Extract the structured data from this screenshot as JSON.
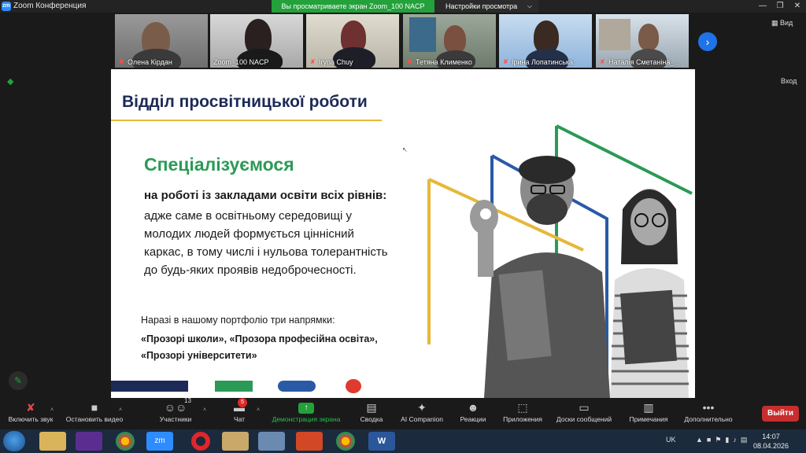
{
  "window": {
    "title": "Zoom Конференция",
    "app_icon": "zm",
    "share_banner": "Вы просматриваете экран Zoom_100 NACP",
    "view_settings_label": "Настройки просмотра",
    "view_label": "Вид",
    "enter_label": "Вход"
  },
  "participants": [
    {
      "name": "Олена Кірдан",
      "muted": true
    },
    {
      "name": "Zoom_100 NACP",
      "muted": false
    },
    {
      "name": "Iryna Chuy",
      "muted": true
    },
    {
      "name": "Тетяна Клименко",
      "muted": true
    },
    {
      "name": "Ірина Лопатинська",
      "muted": true
    },
    {
      "name": "Наталія Сметаніна_...",
      "muted": true
    }
  ],
  "slide": {
    "title": "Відділ просвітницької роботи",
    "subtitle": "Спеціалізуємося",
    "lead": "на роботі із закладами освіти всіх рівнів:",
    "body_lines": [
      "адже саме в освітньому середовищі у",
      "молодих людей формується ціннісний",
      "каркас, в тому числі і нульова толерантність",
      "до будь-яких проявів недоброчесності."
    ],
    "portfolio_intro": "Наразі в нашому портфоліо три напрямки:",
    "portfolio_lines": [
      "«Прозорі школи», «Прозора професійна освіта»,",
      "«Прозорі університети»"
    ],
    "colors": {
      "navy": "#1d2a57",
      "green": "#2b9a56",
      "blue": "#2a5aa6",
      "red": "#e03a2f",
      "gold": "#e6b83a"
    }
  },
  "toolbar": {
    "unmute": "Включить звук",
    "stop_video": "Остановить видео",
    "participants": "Участники",
    "participants_count": "13",
    "chat": "Чат",
    "chat_badge": "5",
    "share_screen": "Демонстрация экрана",
    "summary": "Сводка",
    "ai_companion": "AI Companion",
    "reactions": "Реакции",
    "apps": "Приложения",
    "whiteboards": "Доски сообщений",
    "notes": "Примечания",
    "more": "Дополнительно",
    "leave": "Выйти"
  },
  "taskbar": {
    "language": "UK",
    "time": "14:07",
    "date": "08.04.2026"
  },
  "icons": {
    "start": "windows-start-icon",
    "mic_off": "mic-off-icon",
    "video": "video-camera-icon",
    "participants": "people-icon",
    "chat": "chat-bubble-icon",
    "share": "share-screen-icon",
    "summary": "summary-doc-icon",
    "ai": "sparkle-icon",
    "reactions": "smiley-icon",
    "apps": "apps-icon",
    "whiteboards": "whiteboard-icon",
    "notes": "notes-icon",
    "more": "ellipsis-icon",
    "security": "shield-icon",
    "annotate": "pencil-icon"
  }
}
